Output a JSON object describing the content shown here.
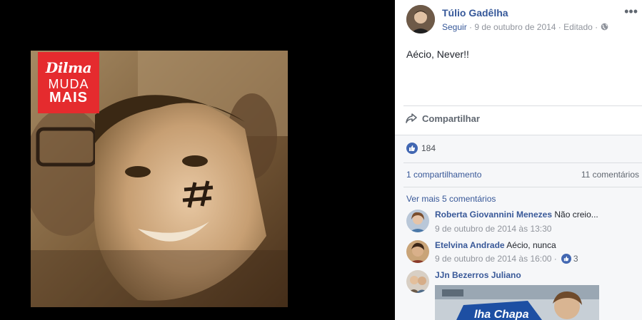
{
  "photo": {
    "badge": {
      "line1": "Dilma",
      "line2": "MUDA",
      "line3": "MAIS"
    },
    "colors": {
      "badge": "#e52b2e",
      "sepia": "#8a6a44"
    }
  },
  "post": {
    "author": "Túlio Gadêlha",
    "follow": "Seguir",
    "meta": "· 9 de outubro de 2014 · Editado ·",
    "text": "Aécio, Never!!",
    "more_icon": "more-dots-icon",
    "privacy_icon": "globe-icon"
  },
  "actions": {
    "share_label": "Compartilhar",
    "share_icon": "share-arrow-icon"
  },
  "stats": {
    "likes": "184",
    "shares": "1 compartilhamento",
    "comments": "11 comentários"
  },
  "comments": {
    "see_more": "Ver mais 5 comentários",
    "items": [
      {
        "name": "Roberta Giovannini Menezes",
        "text": "Não creio...",
        "time": "9 de outubro de 2014 às 13:30",
        "reactions": ""
      },
      {
        "name": "Etelvina Andrade",
        "text": "Aécio, nunca",
        "time": "9 de outubro de 2014 às 16:00 ·",
        "reactions": "3"
      },
      {
        "name": "JJn Bezerros Juliano",
        "text": "",
        "time": "",
        "reactions": ""
      }
    ]
  },
  "colors": {
    "link": "#385898",
    "accent": "#4267b2",
    "panel_bg": "#f6f7f9"
  }
}
